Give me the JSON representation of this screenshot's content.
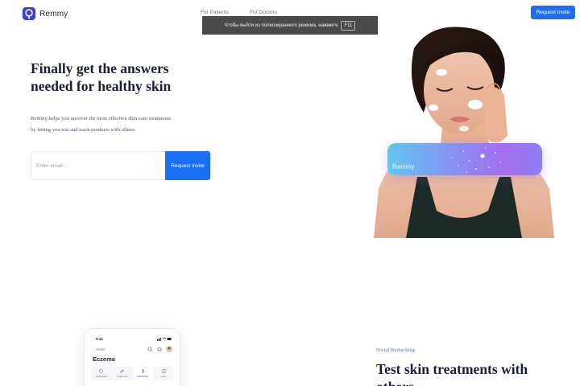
{
  "header": {
    "brand": "Remmy",
    "nav": [
      {
        "label": "For Patients"
      },
      {
        "label": "For Doctors"
      }
    ],
    "cta_label": "Request Invite"
  },
  "fullscreen_banner": {
    "text": "Чтобы выйти из полноэкранного режима, нажмите",
    "key": "F11"
  },
  "hero": {
    "title": "Finally get the answers needed for healthy skin",
    "description": "Remmy helps you uncover the most effective skin care treatments by letting you test and track products with others.",
    "email_placeholder": "Enter email...",
    "email_value": "",
    "cta_label": "Request Invite",
    "card_brand": "Remmy"
  },
  "phone_preview": {
    "time": "9:41",
    "back_label": "Home",
    "title": "Eczema",
    "tabs": [
      {
        "label": "Dashboard"
      },
      {
        "label": "Treatments"
      },
      {
        "label": "Biohacking"
      },
      {
        "label": "Learn"
      }
    ]
  },
  "section": {
    "tag": "Social Biohacking",
    "title": "Test skin treatments with others"
  },
  "colors": {
    "accent": "#1a6ff5",
    "brand": "#3b3fd8",
    "text": "#1a1f36"
  }
}
